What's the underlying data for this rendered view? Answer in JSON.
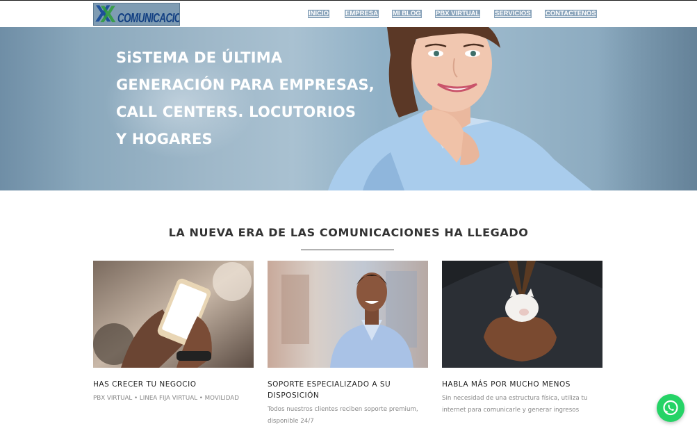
{
  "header": {
    "logo": {
      "mark": "X",
      "text": "COMUNICACIONES"
    },
    "nav": [
      {
        "label": "INICIO"
      },
      {
        "label": "EMPRESA"
      },
      {
        "label": "MI BLOG"
      },
      {
        "label": "PBX VIRTUAL"
      },
      {
        "label": "SERVICIOS"
      },
      {
        "label": "CONTACTENOS"
      }
    ]
  },
  "hero": {
    "lines": [
      "SiSTEMA DE ÚLTIMA",
      "GENERACIÓN PARA EMPRESAS,",
      "CALL CENTERS. LOCUTORIOS",
      "Y HOGARES"
    ]
  },
  "section": {
    "title": "LA NUEVA ERA DE LAS COMUNICACIONES HA LLEGADO"
  },
  "cards": [
    {
      "title": "HAS CRECER TU NEGOCIO",
      "text": "PBX VIRTUAL • LINEA FIJA VIRTUAL • MOVILIDAD",
      "image": "hand-holding-smartphone"
    },
    {
      "title": "SOPORTE ESPECIALIZADO A SU DISPOSICIÓN",
      "text": "Todos nuestros clientes reciben soporte premium, disponible 24/7",
      "image": "smiling-support-man"
    },
    {
      "title": "HABLA MÁS POR MUCHO MENOS",
      "text": "Sin necesidad de una estructura física, utiliza tu internet para comunicarle y generar ingresos",
      "image": "hands-holding-piggy-bank"
    }
  ],
  "colors": {
    "whatsapp": "#25d366",
    "nav_highlight": "#8aa4bb"
  },
  "widgets": {
    "chat_button": "whatsapp-icon"
  }
}
